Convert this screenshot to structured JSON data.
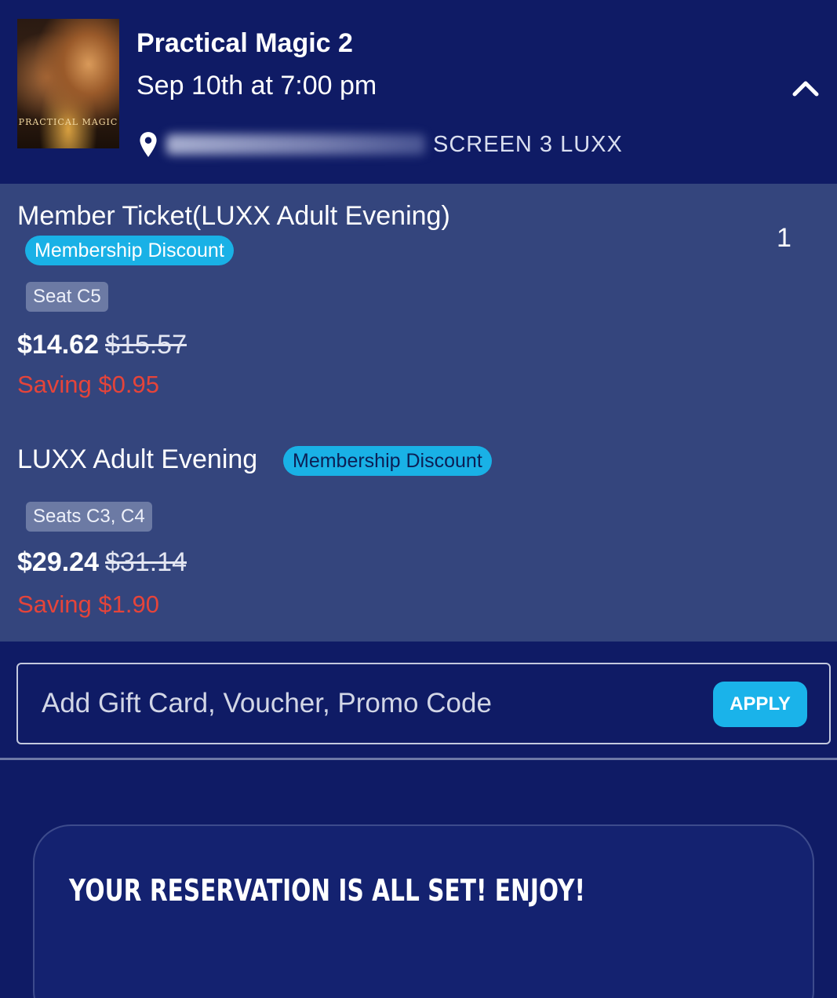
{
  "header": {
    "movie_title": "Practical Magic 2",
    "showtime": "Sep 10th at 7:00 pm",
    "screen_label": "SCREEN 3 LUXX",
    "icons": {
      "location": "location-pin-icon",
      "collapse": "chevron-up-icon"
    },
    "poster": {
      "title_text": "PRACTICAL MAGIC"
    }
  },
  "tickets": [
    {
      "name": "Member Ticket(LUXX Adult Evening)",
      "badge": "Membership Discount",
      "seats": "Seat C5",
      "price": "$14.62",
      "original_price": "$15.57",
      "saving": "Saving $0.95",
      "quantity": "1"
    },
    {
      "name": "LUXX Adult Evening",
      "badge": "Membership Discount",
      "seats": "Seats C3, C4",
      "price": "$29.24",
      "original_price": "$31.14",
      "saving": "Saving $1.90"
    }
  ],
  "promo": {
    "placeholder": "Add Gift Card, Voucher, Promo Code",
    "value": "",
    "apply_label": "APPLY"
  },
  "reservation": {
    "message": "YOUR RESERVATION IS ALL SET! ENJOY!"
  },
  "colors": {
    "background": "#0f1b65",
    "ticket_panel": "#34457d",
    "accent": "#19b1e6",
    "saving": "#e5443a"
  }
}
